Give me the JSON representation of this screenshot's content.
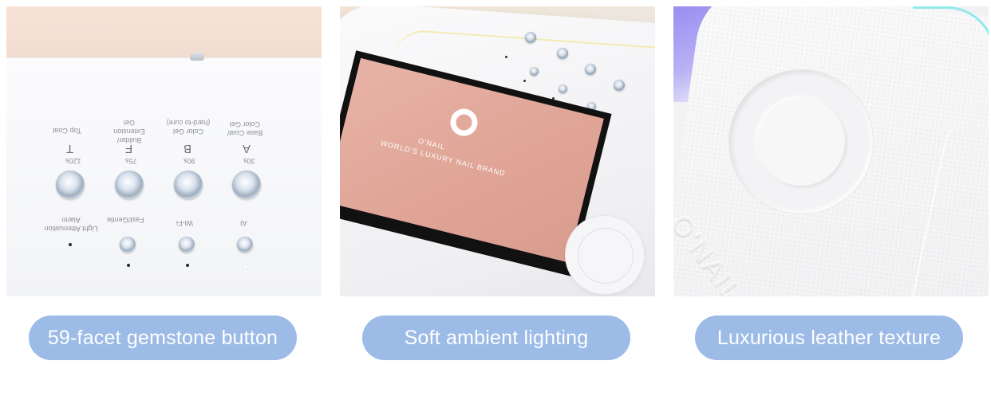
{
  "panels": [
    {
      "caption": "59-facet gemstone button",
      "buttons_top": [
        {
          "time": "120s",
          "letter": "T",
          "desc": "Top Coat"
        },
        {
          "time": "75s",
          "letter": "F",
          "desc": "Builder/ Extension Gel"
        },
        {
          "time": "90s",
          "letter": "B",
          "desc": "Color Gel (hard-to cure)"
        },
        {
          "time": "30s",
          "letter": "A",
          "desc": "Base Coat/ Color Gel"
        }
      ],
      "buttons_bottom": [
        {
          "label": "Light Attenuation Alarm"
        },
        {
          "label": "Fast/Gentle"
        },
        {
          "label": "Wi-Fi"
        },
        {
          "label": "AI"
        }
      ]
    },
    {
      "caption": "Soft ambient lighting",
      "screen_brand": "O'NAIL",
      "screen_slogan": "WORLD'S LUXURY NAIL BRAND"
    },
    {
      "caption": "Luxurious leather texture",
      "emboss_text": "O'NAIL"
    }
  ],
  "colors": {
    "pill_bg": "#9cbbe6",
    "pill_text": "#ffffff",
    "screen_pink": "#e0a698",
    "ambient_glow": "#f2e9a8",
    "edge_cyan": "#7fe8ea",
    "accent_purple": "#9a8df0"
  }
}
